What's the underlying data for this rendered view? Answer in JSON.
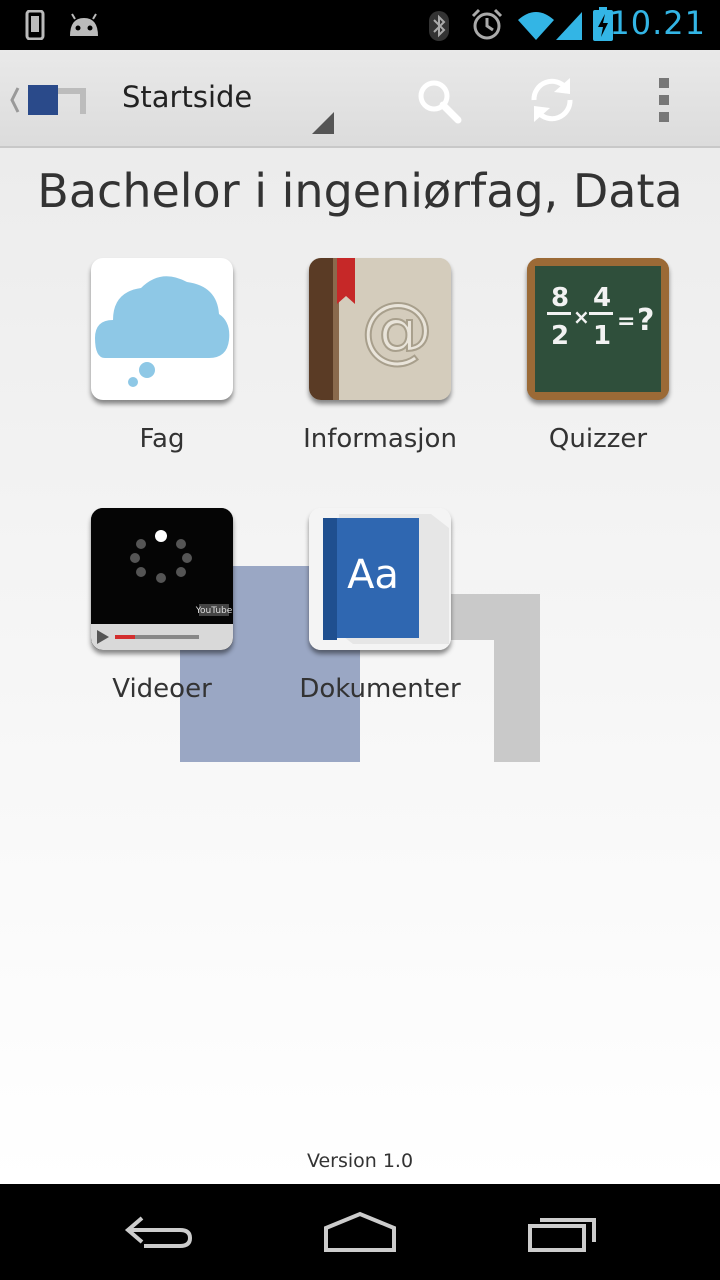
{
  "status_bar": {
    "time": "10.21",
    "icons": [
      "phone-icon",
      "android-icon",
      "bluetooth-icon",
      "alarm-icon",
      "wifi-icon",
      "signal-icon",
      "battery-charging-icon"
    ]
  },
  "action_bar": {
    "title": "Startside",
    "accent_color": "#2a4a8a",
    "actions": [
      "search-icon",
      "refresh-icon",
      "overflow-menu-icon"
    ]
  },
  "main": {
    "heading": "Bachelor i ingeniørfag, Data",
    "tiles": [
      {
        "label": "Fag",
        "icon": "cloud-icon"
      },
      {
        "label": "Informasjon",
        "icon": "address-book-icon"
      },
      {
        "label": "Quizzer",
        "icon": "chalkboard-icon"
      },
      {
        "label": "Videoer",
        "icon": "video-player-icon"
      },
      {
        "label": "Dokumenter",
        "icon": "dictionary-book-icon"
      }
    ],
    "version": "Version 1.0"
  },
  "nav_bar": {
    "buttons": [
      "back-icon",
      "home-icon",
      "recent-apps-icon"
    ]
  }
}
